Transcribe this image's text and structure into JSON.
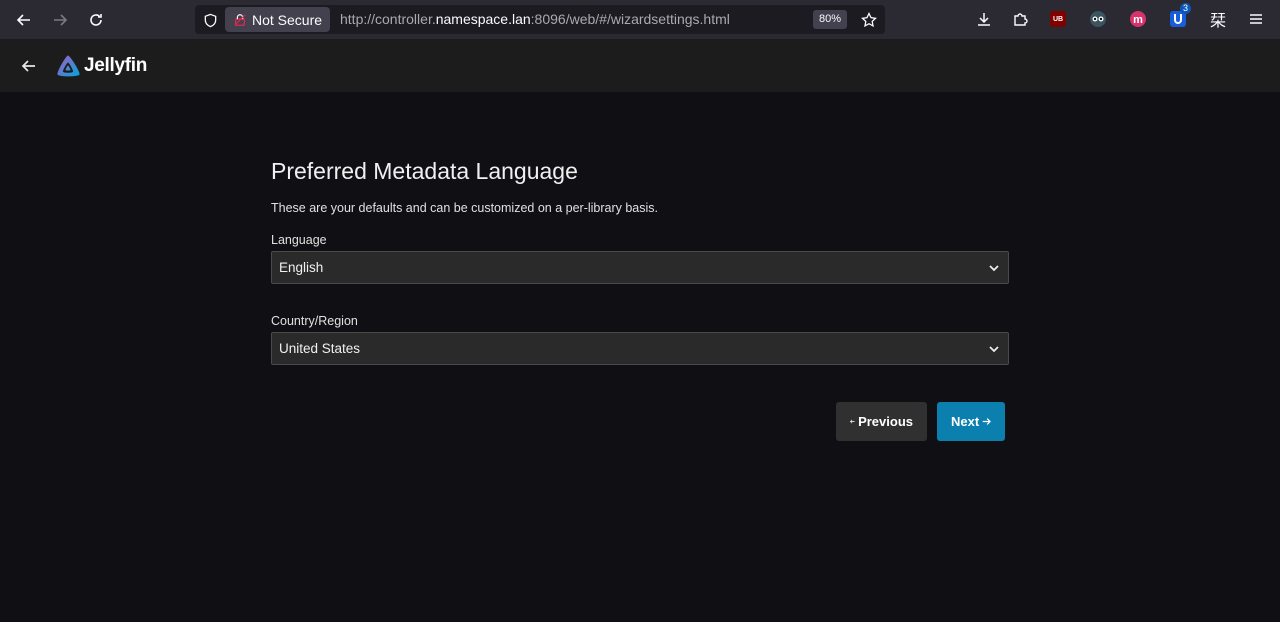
{
  "browser": {
    "not_secure_label": "Not Secure",
    "url_prefix": "http://controller.",
    "url_host": "namespace.lan",
    "url_suffix": ":8096/web/#/wizardsettings.html",
    "zoom": "80%",
    "extension_badge_count": "3",
    "ext_kanji": "栞",
    "ext_ub_label": "UB"
  },
  "app": {
    "name": "Jellyfin"
  },
  "wizard": {
    "title": "Preferred Metadata Language",
    "description": "These are your defaults and can be customized on a per-library basis.",
    "language_label": "Language",
    "language_value": "English",
    "country_label": "Country/Region",
    "country_value": "United States",
    "previous_label": "Previous",
    "next_label": "Next"
  },
  "colors": {
    "accent": "#0b7fae",
    "background": "#101014",
    "header": "#1c1c1c"
  }
}
